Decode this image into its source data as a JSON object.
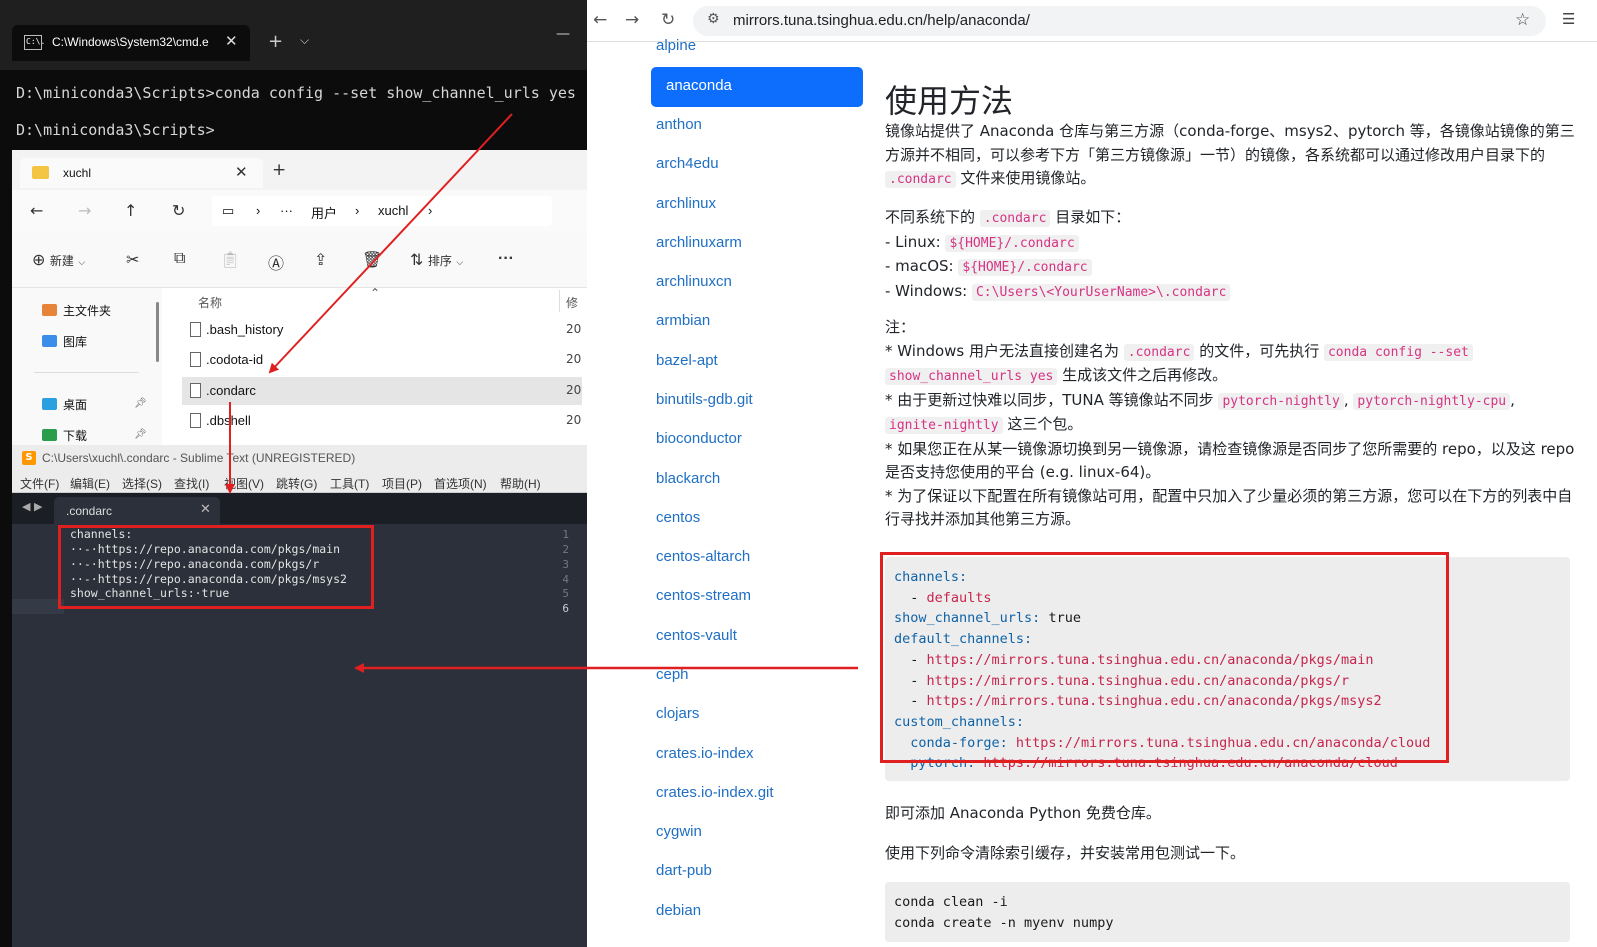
{
  "cmd": {
    "tab_title": "C:\\Windows\\System32\\cmd.e",
    "icon_text": "C:\\.",
    "lines": [
      "D:\\miniconda3\\Scripts>conda config --set show_channel_urls yes",
      "D:\\miniconda3\\Scripts>"
    ]
  },
  "explorer": {
    "tab_title": "xuchl",
    "breadcrumb": [
      "用户",
      "xuchl"
    ],
    "toolbar": {
      "new": "新建",
      "sort": "排序"
    },
    "nav": [
      {
        "label": "主文件夹",
        "pinned": false
      },
      {
        "label": "图库",
        "pinned": false
      },
      {
        "label": "桌面",
        "pinned": true
      },
      {
        "label": "下载",
        "pinned": true
      }
    ],
    "columns": {
      "name": "名称",
      "date": "修"
    },
    "files": [
      {
        "name": ".bash_history",
        "date": "20"
      },
      {
        "name": ".codota-id",
        "date": "20"
      },
      {
        "name": ".condarc",
        "date": "20",
        "selected": true
      },
      {
        "name": ".dbshell",
        "date": "20"
      }
    ]
  },
  "sublime": {
    "title": "C:\\Users\\xuchl\\.condarc - Sublime Text (UNREGISTERED)",
    "menu": [
      "文件(F)",
      "编辑(E)",
      "选择(S)",
      "查找(I)",
      "视图(V)",
      "跳转(G)",
      "工具(T)",
      "项目(P)",
      "首选项(N)",
      "帮助(H)"
    ],
    "tab_name": ".condarc",
    "lines": [
      "channels:",
      "··-·https://repo.anaconda.com/pkgs/main",
      "··-·https://repo.anaconda.com/pkgs/r",
      "··-·https://repo.anaconda.com/pkgs/msys2",
      "show_channel_urls:·true",
      ""
    ],
    "line_numbers": [
      "1",
      "2",
      "3",
      "4",
      "5",
      "6"
    ]
  },
  "browser": {
    "url": "mirrors.tuna.tsinghua.edu.cn/help/anaconda/",
    "sidebar": [
      "alpine",
      "anaconda",
      "anthon",
      "arch4edu",
      "archlinux",
      "archlinuxarm",
      "archlinuxcn",
      "armbian",
      "bazel-apt",
      "binutils-gdb.git",
      "bioconductor",
      "blackarch",
      "centos",
      "centos-altarch",
      "centos-stream",
      "centos-vault",
      "ceph",
      "clojars",
      "crates.io-index",
      "crates.io-index.git",
      "cygwin",
      "dart-pub",
      "debian"
    ],
    "active_item": "anaconda",
    "heading": "使用方法",
    "intro_1": "镜像站提供了 Anaconda 仓库与第三方源（conda-forge、msys2、pytorch 等，各镜像站镜像的第三方源并不相同，可以参考下方「第三方镜像源」一节）的镜像，各系统都可以通过修改用户目录下的",
    "intro_code": ".condarc",
    "intro_2": "文件来使用镜像站。",
    "dirs_1": "不同系统下的",
    "dirs_code": ".condarc",
    "dirs_2": "目录如下：",
    "os": [
      {
        "label": "- Linux:",
        "path": "${HOME}/.condarc"
      },
      {
        "label": "- macOS:",
        "path": "${HOME}/.condarc"
      },
      {
        "label": "- Windows:",
        "path": "C:\\Users\\<YourUserName>\\.condarc"
      }
    ],
    "note_title": "注：",
    "note1_a": "* Windows 用户无法直接创建名为",
    "note1_code1": ".condarc",
    "note1_b": "的文件，可先执行",
    "note1_code2a": "conda config --set",
    "note1_code2b": "show_channel_urls yes",
    "note1_c": "生成该文件之后再修改。",
    "note2_a": "* 由于更新过快难以同步，TUNA 等镜像站不同步",
    "note2_code1": "pytorch-nightly",
    "note2_sep": ",",
    "note2_code2": "pytorch-nightly-cpu",
    "note2_sep2": ",",
    "note2_code3": "ignite-nightly",
    "note2_b": "这三个包。",
    "note3": "* 如果您正在从某一镜像源切换到另一镜像源，请检查镜像源是否同步了您所需要的 repo，以及这 repo 是否支持您使用的平台 (e.g. linux-64)。",
    "note4": "* 为了保证以下配置在所有镜像站可用，配置中只加入了少量必须的第三方源，您可以在下方的列表中自行寻找并添加其他第三方源。",
    "config": {
      "k_channels": "channels:",
      "dash": "  - ",
      "defaults": "defaults",
      "k_show": "show_channel_urls:",
      "v_true": " true",
      "k_default": "default_channels:",
      "urls": [
        "https://mirrors.tuna.tsinghua.edu.cn/anaconda/pkgs/main",
        "https://mirrors.tuna.tsinghua.edu.cn/anaconda/pkgs/r",
        "https://mirrors.tuna.tsinghua.edu.cn/anaconda/pkgs/msys2"
      ],
      "k_custom": "custom_channels:",
      "k_forge": "  conda-forge:",
      "k_pytorch": "  pytorch:",
      "cloud": " https://mirrors.tuna.tsinghua.edu.cn/anaconda/cloud"
    },
    "after_config": "即可添加 Anaconda Python 免费仓库。",
    "clean_intro": "使用下列命令清除索引缓存，并安装常用包测试一下。",
    "commands": [
      "conda clean -i",
      "conda create -n myenv numpy"
    ]
  },
  "colors": {
    "annotation": "#e02020",
    "link": "#1f6fc5",
    "active": "#0d6efd"
  }
}
